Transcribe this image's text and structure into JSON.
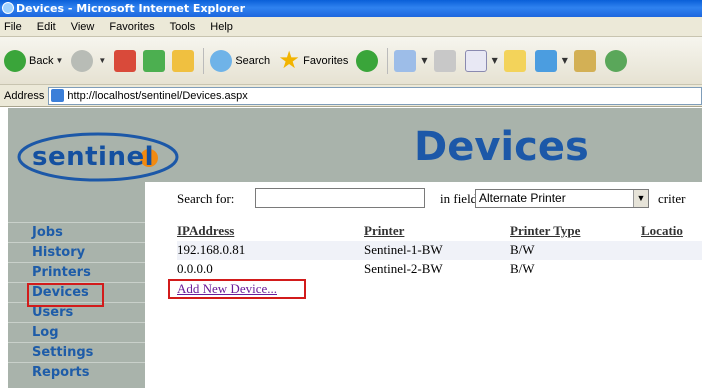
{
  "window": {
    "title": "Devices - Microsoft Internet Explorer"
  },
  "menu": [
    "File",
    "Edit",
    "View",
    "Favorites",
    "Tools",
    "Help"
  ],
  "toolbar": {
    "back_label": "Back",
    "search_label": "Search",
    "favorites_label": "Favorites"
  },
  "address": {
    "label": "Address",
    "url": "http://localhost/sentinel/Devices.aspx"
  },
  "logo": {
    "text": "sentinel"
  },
  "page_title": "Devices",
  "nav": [
    "Jobs",
    "History",
    "Printers",
    "Devices",
    "Users",
    "Log",
    "Settings",
    "Reports"
  ],
  "search": {
    "label": "Search for:",
    "value": "",
    "field_label": "in field:",
    "field_value": "Alternate Printer",
    "criteria_label": "criter"
  },
  "table": {
    "headers": [
      "IPAddress",
      "Printer",
      "Printer Type",
      "Locatio"
    ],
    "rows": [
      [
        "192.168.0.81",
        "Sentinel-1-BW",
        "B/W",
        ""
      ],
      [
        "0.0.0.0",
        "Sentinel-2-BW",
        "B/W",
        ""
      ]
    ]
  },
  "add_link": "Add New Device...",
  "colors": {
    "titlebar": "#0a5fd8",
    "sidebar": "#a9b3ab",
    "nav_text": "#1e5ca8",
    "title_text": "#1c58a8",
    "highlight": "#d21b1b"
  }
}
